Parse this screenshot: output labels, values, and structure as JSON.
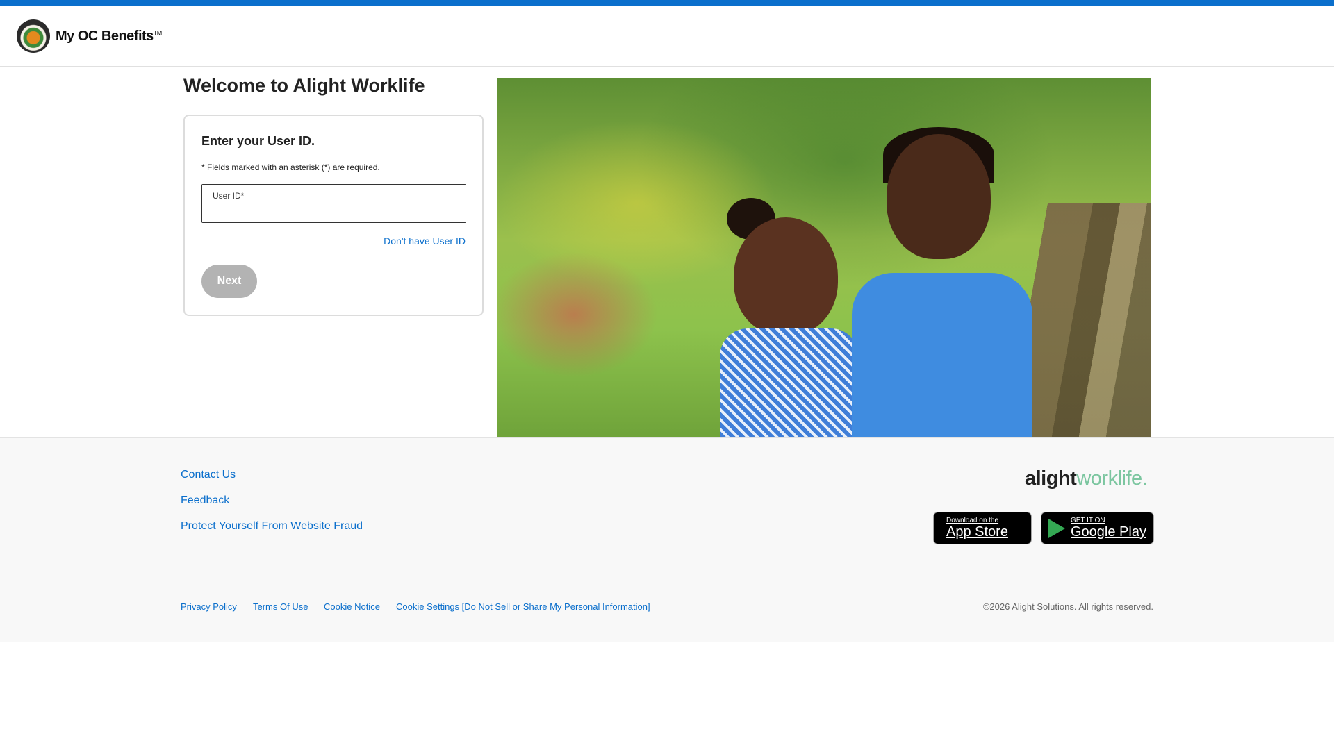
{
  "header": {
    "brand": "My OC Benefits",
    "trademark": "TM"
  },
  "main": {
    "welcome": "Welcome to Alight Worklife",
    "card_title": "Enter your User ID.",
    "required_note": "* Fields marked with an asterisk (*) are required.",
    "userid_label": "User ID*",
    "userid_value": "",
    "no_userid_link": "Don't have User ID",
    "next_button": "Next"
  },
  "footer": {
    "links": [
      "Contact Us",
      "Feedback",
      "Protect Yourself From Website Fraud"
    ],
    "alight_logo": {
      "part1": "alight",
      "part2": "worklife."
    },
    "app_store": {
      "small": "Download on the",
      "big": "App Store"
    },
    "google_play": {
      "small": "GET IT ON",
      "big": "Google Play"
    },
    "legal_links": [
      "Privacy Policy",
      "Terms Of Use",
      "Cookie Notice",
      "Cookie Settings [Do Not Sell or Share My Personal Information]"
    ],
    "copyright": "©2026 Alight Solutions. All rights reserved."
  },
  "colors": {
    "accent": "#0b6fcc",
    "button_disabled": "#b3b3b3",
    "worklife_green": "#7cc6a0"
  }
}
